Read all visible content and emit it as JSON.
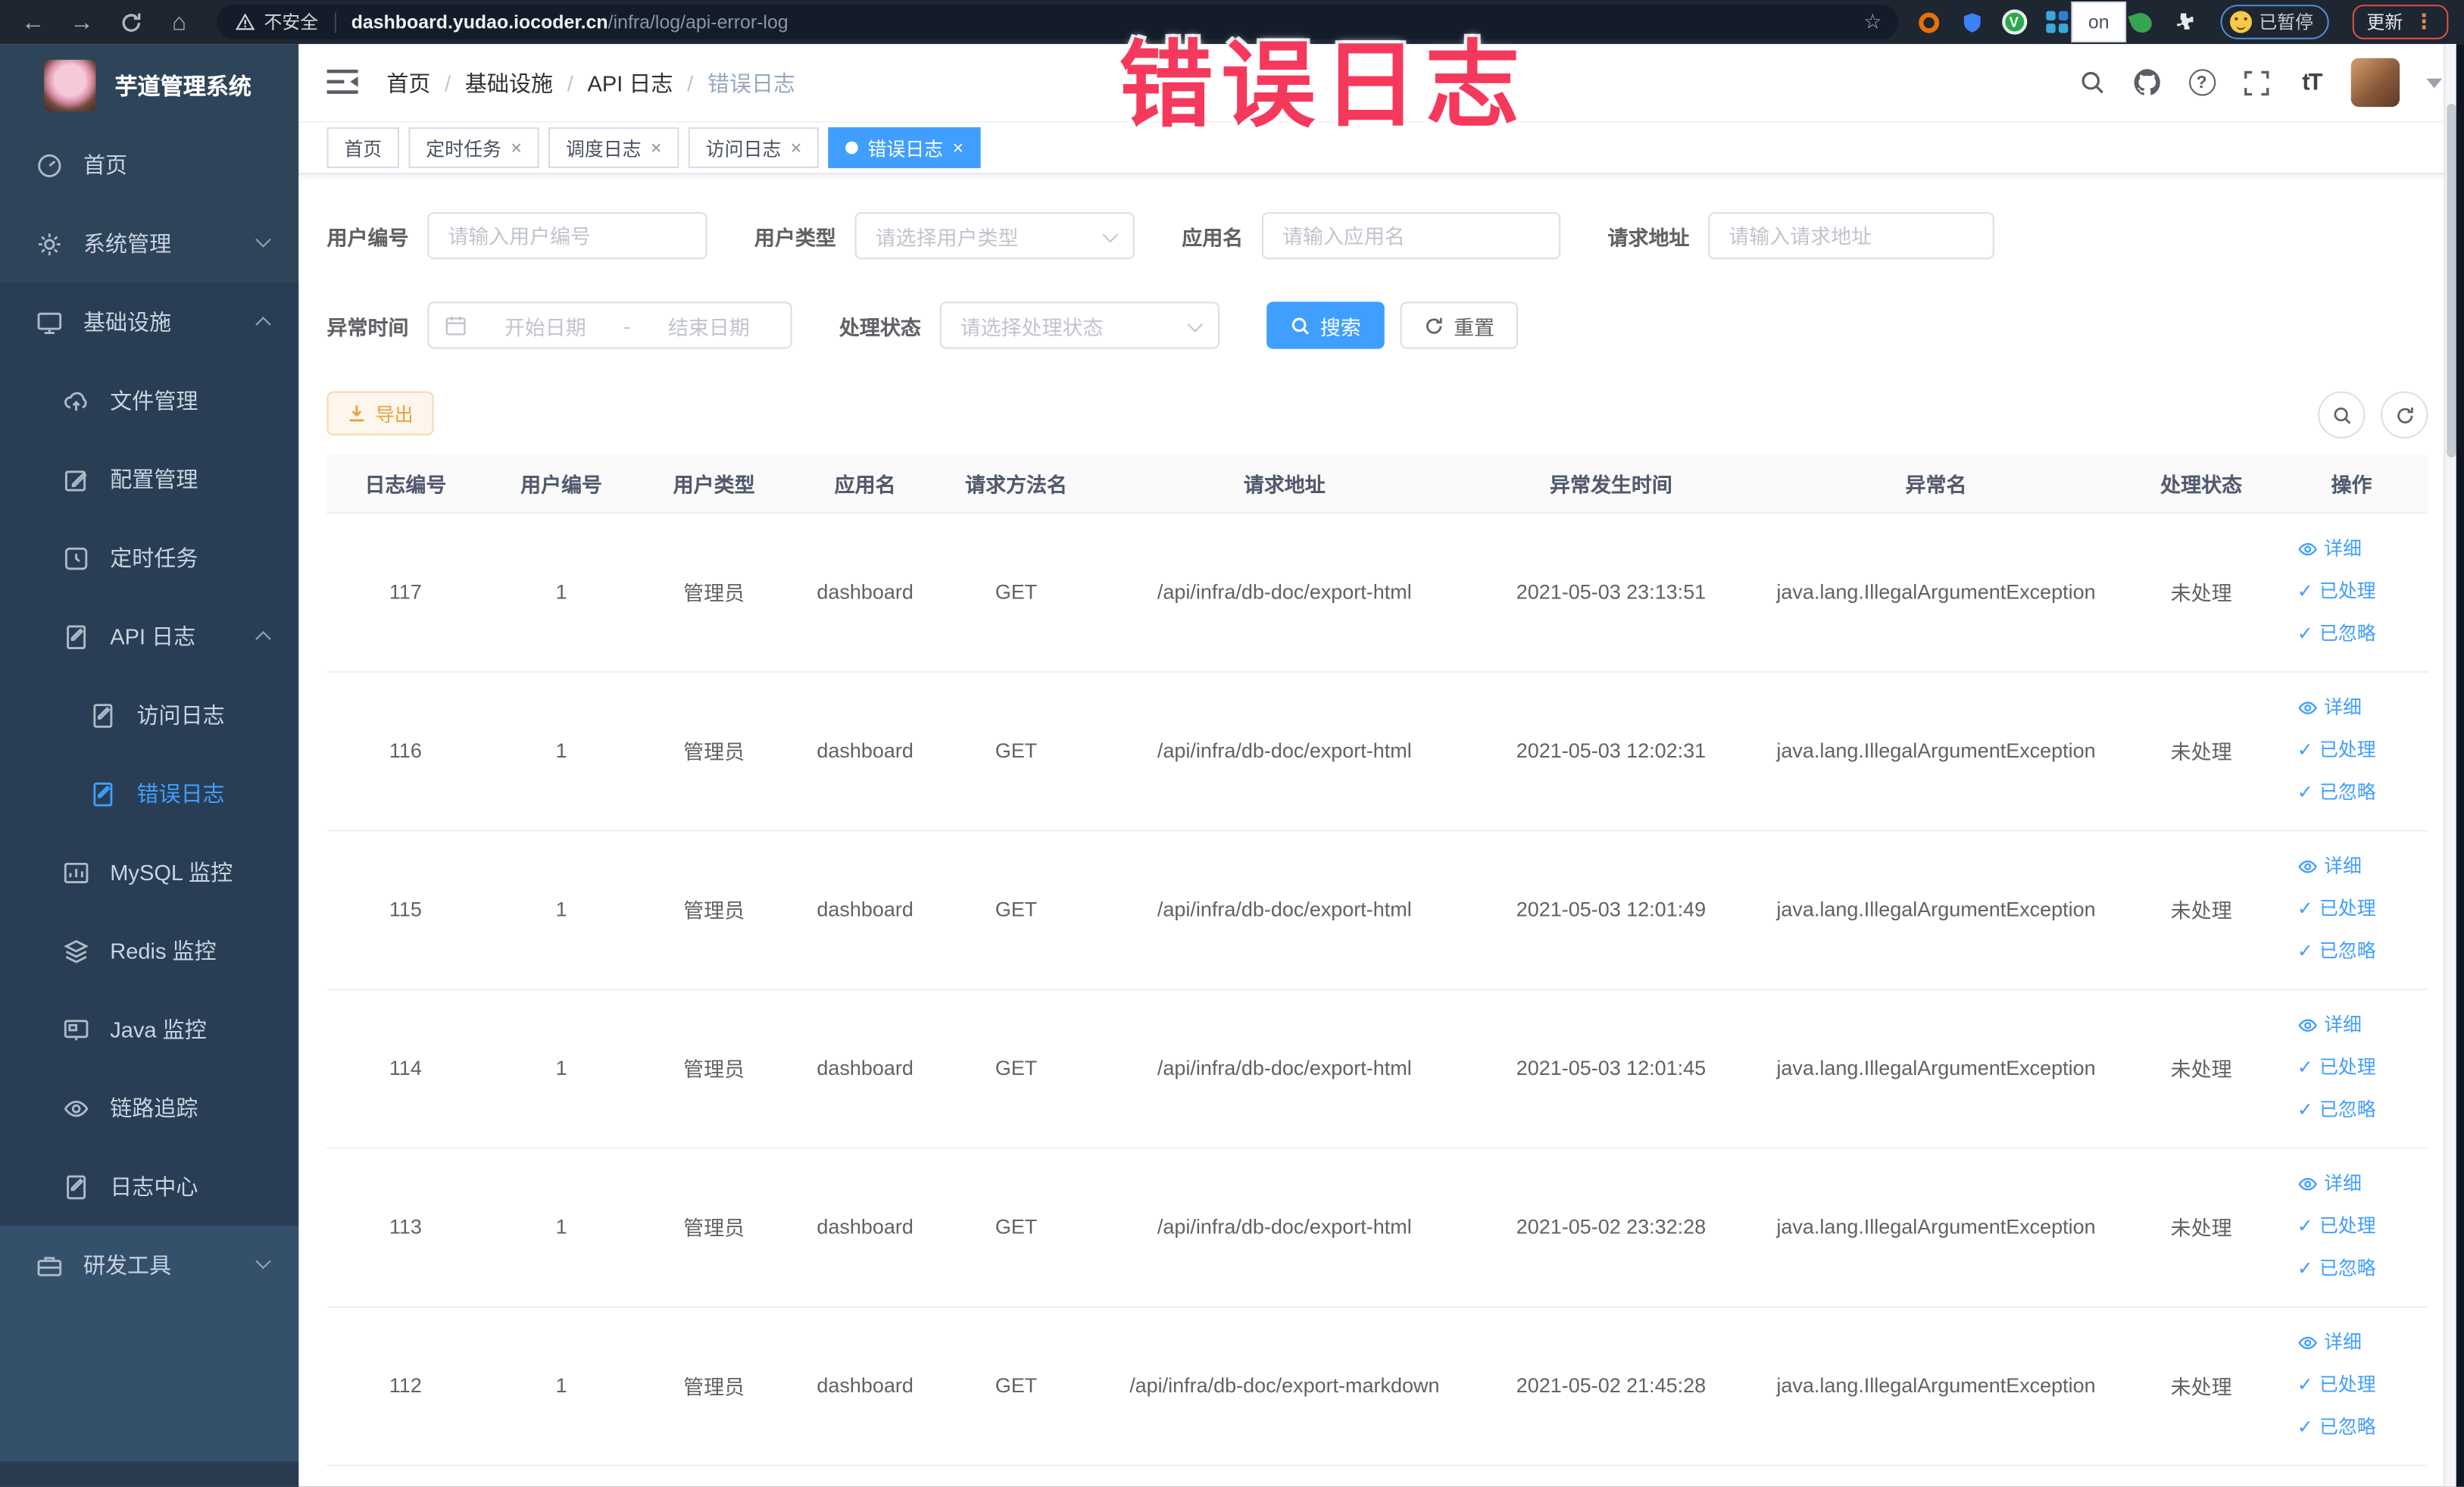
{
  "overlay": {
    "text": "错误日志"
  },
  "browser": {
    "security_label": "不安全",
    "url_host": "dashboard.yudao.iocoder.cn",
    "url_path": "/infra/log/api-error-log",
    "paused_badge_label": "已暂停",
    "update_button_label": "更新"
  },
  "icons": {
    "back": "←",
    "forward": "→",
    "home": "⌂",
    "star": "☆",
    "dots_vertical": "⋮",
    "close": "×",
    "check": "✓",
    "question": "?",
    "font_size": "tT",
    "on_badge": "on",
    "breadcrumb_sep": "/"
  },
  "header": {
    "breadcrumb": [
      "首页",
      "基础设施",
      "API 日志",
      "错误日志"
    ]
  },
  "tabs": [
    {
      "label": "首页",
      "closable": false,
      "active": false
    },
    {
      "label": "定时任务",
      "closable": true,
      "active": false
    },
    {
      "label": "调度日志",
      "closable": true,
      "active": false
    },
    {
      "label": "访问日志",
      "closable": true,
      "active": false
    },
    {
      "label": "错误日志",
      "closable": true,
      "active": true
    }
  ],
  "sidebar": {
    "logo_title": "芋道管理系统",
    "items": [
      {
        "label": "首页"
      },
      {
        "label": "系统管理"
      },
      {
        "label": "基础设施"
      },
      {
        "label": "文件管理"
      },
      {
        "label": "配置管理"
      },
      {
        "label": "定时任务"
      },
      {
        "label": "API 日志"
      },
      {
        "label": "访问日志"
      },
      {
        "label": "错误日志"
      },
      {
        "label": "MySQL 监控"
      },
      {
        "label": "Redis 监控"
      },
      {
        "label": "Java 监控"
      },
      {
        "label": "链路追踪"
      },
      {
        "label": "日志中心"
      },
      {
        "label": "研发工具"
      }
    ]
  },
  "filters": {
    "user_id": {
      "label": "用户编号",
      "placeholder": "请输入用户编号"
    },
    "user_type": {
      "label": "用户类型",
      "placeholder": "请选择用户类型"
    },
    "app_name": {
      "label": "应用名",
      "placeholder": "请输入应用名"
    },
    "request_url": {
      "label": "请求地址",
      "placeholder": "请输入请求地址"
    },
    "exception_time": {
      "label": "异常时间",
      "start_placeholder": "开始日期",
      "separator": "-",
      "end_placeholder": "结束日期"
    },
    "process_status": {
      "label": "处理状态",
      "placeholder": "请选择处理状态"
    },
    "search_label": "搜索",
    "reset_label": "重置"
  },
  "toolbar": {
    "export_label": "导出"
  },
  "table": {
    "headers": [
      "日志编号",
      "用户编号",
      "用户类型",
      "应用名",
      "请求方法名",
      "请求地址",
      "异常发生时间",
      "异常名",
      "处理状态",
      "操作"
    ],
    "actions": {
      "detail": "详细",
      "processed": "已处理",
      "ignored": "已忽略"
    },
    "rows": [
      {
        "id": "117",
        "user_id": "1",
        "user_type": "管理员",
        "app_name": "dashboard",
        "method": "GET",
        "url": "/api/infra/db-doc/export-html",
        "time": "2021-05-03 23:13:51",
        "exception": "java.lang.IllegalArgumentException",
        "status": "未处理"
      },
      {
        "id": "116",
        "user_id": "1",
        "user_type": "管理员",
        "app_name": "dashboard",
        "method": "GET",
        "url": "/api/infra/db-doc/export-html",
        "time": "2021-05-03 12:02:31",
        "exception": "java.lang.IllegalArgumentException",
        "status": "未处理"
      },
      {
        "id": "115",
        "user_id": "1",
        "user_type": "管理员",
        "app_name": "dashboard",
        "method": "GET",
        "url": "/api/infra/db-doc/export-html",
        "time": "2021-05-03 12:01:49",
        "exception": "java.lang.IllegalArgumentException",
        "status": "未处理"
      },
      {
        "id": "114",
        "user_id": "1",
        "user_type": "管理员",
        "app_name": "dashboard",
        "method": "GET",
        "url": "/api/infra/db-doc/export-html",
        "time": "2021-05-03 12:01:45",
        "exception": "java.lang.IllegalArgumentException",
        "status": "未处理"
      },
      {
        "id": "113",
        "user_id": "1",
        "user_type": "管理员",
        "app_name": "dashboard",
        "method": "GET",
        "url": "/api/infra/db-doc/export-html",
        "time": "2021-05-02 23:32:28",
        "exception": "java.lang.IllegalArgumentException",
        "status": "未处理"
      },
      {
        "id": "112",
        "user_id": "1",
        "user_type": "管理员",
        "app_name": "dashboard",
        "method": "GET",
        "url": "/api/infra/db-doc/export-markdown",
        "time": "2021-05-02 21:45:28",
        "exception": "java.lang.IllegalArgumentException",
        "status": "未处理"
      }
    ]
  },
  "colors": {
    "accent": "#409eff",
    "warning_text": "#e6a23c",
    "warning_bg": "#fdf6ec",
    "warning_border": "#f5dab1",
    "sidebar_bg": "#2e4459",
    "overlay_red": "#f5395c",
    "update_border": "#d95140",
    "paused_border": "#4f8cd0"
  }
}
